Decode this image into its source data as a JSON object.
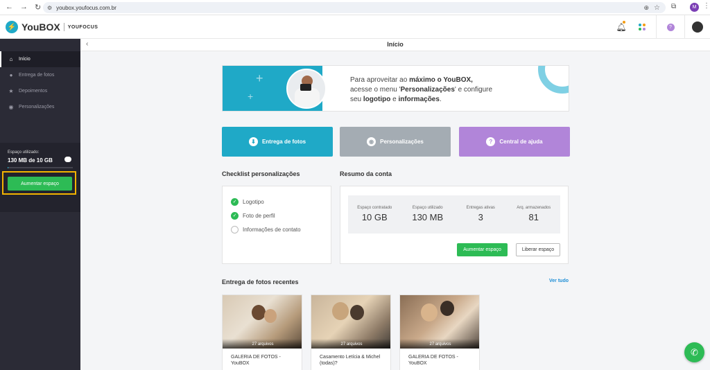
{
  "browser": {
    "url": "youbox.youfocus.com.br",
    "profile_initial": "M"
  },
  "app": {
    "logo_name": "YouBOX",
    "logo_sub": "YOUFOCUS"
  },
  "sidebar": {
    "items": [
      {
        "label": "Início",
        "icon": "home-icon"
      },
      {
        "label": "Entrega de fotos",
        "icon": "gear-icon"
      },
      {
        "label": "Depoimentos",
        "icon": "star-icon"
      },
      {
        "label": "Personalizações",
        "icon": "palette-icon"
      }
    ],
    "storage_label": "Espaço utilizado:",
    "storage_value": "130 MB de 10 GB",
    "storage_fraction": 0.013,
    "increase_button": "Aumentar espaço"
  },
  "page": {
    "title": "Início"
  },
  "banner": {
    "line1_pre": "Para aproveitar ao ",
    "line1_bold": "máximo o YouBOX,",
    "line2_pre": "acesse o menu '",
    "line2_bold": "Personalizações",
    "line2_post": "' e configure",
    "line3_pre": "seu ",
    "line3_bold1": "logotipo",
    "line3_mid": " e ",
    "line3_bold2": "informações",
    "line3_post": "."
  },
  "quick_actions": [
    {
      "label": "Entrega de fotos",
      "icon": "download-icon",
      "color": "#1fa9c7"
    },
    {
      "label": "Personalizações",
      "icon": "palette-icon",
      "color": "#a4acb3"
    },
    {
      "label": "Central de ajuda",
      "icon": "help-icon",
      "color": "#b185d9"
    }
  ],
  "checklist": {
    "title": "Checklist personalizações",
    "items": [
      {
        "label": "Logotipo",
        "done": true
      },
      {
        "label": "Foto de perfil",
        "done": true
      },
      {
        "label": "Informações de contato",
        "done": false
      }
    ]
  },
  "account": {
    "title": "Resumo da conta",
    "stats": [
      {
        "label": "Espaço contratado",
        "value": "10 GB"
      },
      {
        "label": "Espaço utilizado",
        "value": "130 MB"
      },
      {
        "label": "Entregas ativas",
        "value": "3"
      },
      {
        "label": "Arq. armazenados",
        "value": "81"
      }
    ],
    "increase_button": "Aumentar espaço",
    "free_button": "Liberar espaço"
  },
  "recent": {
    "title": "Entrega de fotos recentes",
    "see_all": "Ver tudo",
    "galleries": [
      {
        "count": "27 arquivos",
        "title": "GALERIA DE FOTOS - YouBOX"
      },
      {
        "count": "27 arquivos",
        "title": "Casamento Letícia & Michel (todas)?"
      },
      {
        "count": "27 arquivos",
        "title": "GALERIA DE FOTOS - YouBOX"
      }
    ]
  },
  "colors": {
    "accent": "#1fa9c7",
    "success": "#2dbb55",
    "sidebar": "#2b2b36",
    "highlight": "#f4b400"
  }
}
